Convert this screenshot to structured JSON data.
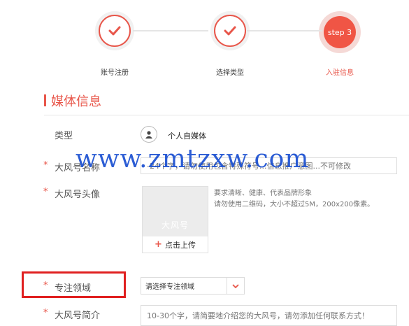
{
  "stepper": {
    "steps": [
      {
        "label": "账号注册",
        "state": "done",
        "icon": "check-icon"
      },
      {
        "label": "选择类型",
        "state": "done",
        "icon": "check-icon"
      },
      {
        "label": "入驻信息",
        "state": "current",
        "badge": "step 3"
      }
    ]
  },
  "section": {
    "title": "媒体信息"
  },
  "form": {
    "type": {
      "label": "类型",
      "value": "个人自媒体",
      "icon": "user-icon"
    },
    "name": {
      "label": "大风号名称",
      "required": "*",
      "placeholder": "2-24个字，请勿使用包含特殊符号或含有明显营销推广意图的账号名，不可修改",
      "visible_placeholder": "-24个字，请勿使用包含特殊符号...信息推广意图...不可修改"
    },
    "avatar": {
      "label": "大风号头像",
      "required": "*",
      "watermark": "大风号",
      "upload_label": "点击上传",
      "hint1": "要求清晰、健康、代表品牌形象",
      "hint2": "请勿使用二维码，大小不超过5M，200x200像素。"
    },
    "domain": {
      "label": "专注领域",
      "required": "*",
      "select_value": "请选择专注领域"
    },
    "intro": {
      "label": "大风号简介",
      "required": "*",
      "placeholder": "10-30个字，请简要地介绍您的大风号，请勿添加任何联系方式！"
    }
  },
  "overlay_watermark": "www.zmtzxw.com",
  "colors": {
    "accent": "#e8564a",
    "highlight": "#e02020",
    "watermark": "#1a4fd1"
  }
}
